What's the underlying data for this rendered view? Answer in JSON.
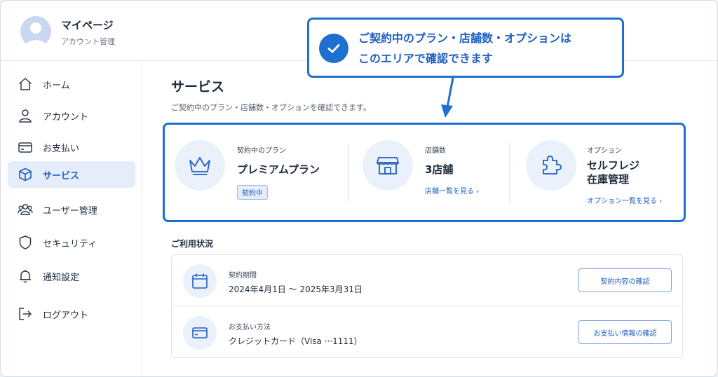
{
  "header": {
    "user_name": "マイページ",
    "user_sub": "アカウント管理"
  },
  "sidebar": {
    "items": [
      {
        "label": "ホーム",
        "icon": "home-icon"
      },
      {
        "label": "アカウント",
        "icon": "user-icon"
      },
      {
        "label": "お支払い",
        "icon": "card-icon"
      },
      {
        "label": "サービス",
        "icon": "cube-icon",
        "active": true
      },
      {
        "label": "ユーザー管理",
        "icon": "users-icon"
      },
      {
        "label": "セキュリティ",
        "icon": "shield-icon"
      },
      {
        "label": "通知設定",
        "icon": "bell-icon"
      },
      {
        "label": "ログアウト",
        "icon": "logout-icon"
      }
    ]
  },
  "main": {
    "title": "サービス",
    "description": "ご契約中のプラン・店舗数・オプションを確認できます。",
    "plan": {
      "label": "契約中のプラン",
      "value": "プレミアムプラン",
      "badge": "契約中",
      "icon": "crown-icon"
    },
    "stores": {
      "label": "店舗数",
      "value": "3店舗",
      "link": "店舗一覧を見る ›",
      "icon": "store-icon"
    },
    "options": {
      "label": "オプション",
      "value_line1": "セルフレジ",
      "value_line2": "在庫管理",
      "link": "オプション一覧を見る ›",
      "icon": "puzzle-icon"
    },
    "usage": {
      "title": "ご利用状況",
      "rows": [
        {
          "label": "契約期間",
          "value": "2024年4月1日 〜 2025年3月31日",
          "button": "契約内容の確認",
          "icon": "calendar-icon"
        },
        {
          "label": "お支払い方法",
          "value": "クレジットカード（Visa ···1111）",
          "button": "お支払い情報の確認",
          "icon": "credit-card-icon"
        }
      ]
    }
  },
  "callout": {
    "line1": "ご契約中のプラン・店舗数・オプションは",
    "line2": "このエリアで確認できます"
  },
  "colors": {
    "accent": "#1f6fd1",
    "active_bg": "#e4edf9",
    "icon_circle": "#eaf1fb"
  }
}
